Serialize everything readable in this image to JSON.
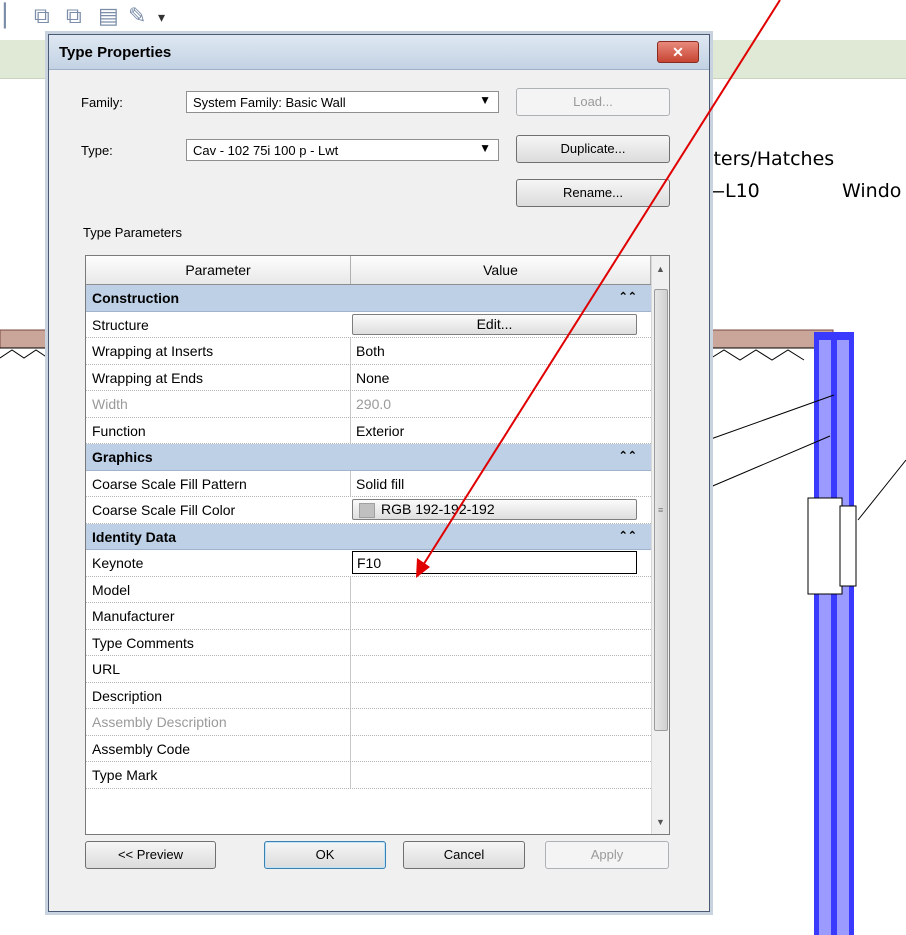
{
  "dialog": {
    "title": "Type Properties",
    "close_label": "✕"
  },
  "family": {
    "label": "Family:",
    "value": "System Family: Basic Wall"
  },
  "type": {
    "label": "Type:",
    "value": "Cav - 102 75i 100 p - Lwt"
  },
  "buttons": {
    "load": "Load...",
    "duplicate": "Duplicate...",
    "rename": "Rename...",
    "preview": "<< Preview",
    "ok": "OK",
    "cancel": "Cancel",
    "apply": "Apply"
  },
  "type_parameters_label": "Type Parameters",
  "grid": {
    "headers": [
      "Parameter",
      "Value"
    ],
    "groups": {
      "construction": "Construction",
      "graphics": "Graphics",
      "identity": "Identity Data"
    },
    "rows": {
      "structure": {
        "p": "Structure",
        "v": "Edit..."
      },
      "wrap_inserts": {
        "p": "Wrapping at Inserts",
        "v": "Both"
      },
      "wrap_ends": {
        "p": "Wrapping at Ends",
        "v": "None"
      },
      "width": {
        "p": "Width",
        "v": "290.0"
      },
      "function": {
        "p": "Function",
        "v": "Exterior"
      },
      "fill_pattern": {
        "p": "Coarse Scale Fill Pattern",
        "v": "Solid fill"
      },
      "fill_color": {
        "p": "Coarse Scale Fill Color",
        "v": "RGB 192-192-192"
      },
      "keynote": {
        "p": "Keynote",
        "v": "F10"
      },
      "model": {
        "p": "Model",
        "v": ""
      },
      "manufacturer": {
        "p": "Manufacturer",
        "v": ""
      },
      "type_comments": {
        "p": "Type Comments",
        "v": ""
      },
      "url": {
        "p": "URL",
        "v": ""
      },
      "description": {
        "p": "Description",
        "v": ""
      },
      "assembly_description": {
        "p": "Assembly Description",
        "v": ""
      },
      "assembly_code": {
        "p": "Assembly Code",
        "v": ""
      },
      "type_mark": {
        "p": "Type Mark",
        "v": ""
      }
    }
  },
  "canvas": {
    "label_hatches": "tters/Hatches",
    "label_level": "—L10",
    "label_window": "Windo"
  },
  "colors": {
    "wall_blue": "#3a3aff",
    "arrow_red": "#e00000",
    "group_header": "#bdd0e6"
  }
}
